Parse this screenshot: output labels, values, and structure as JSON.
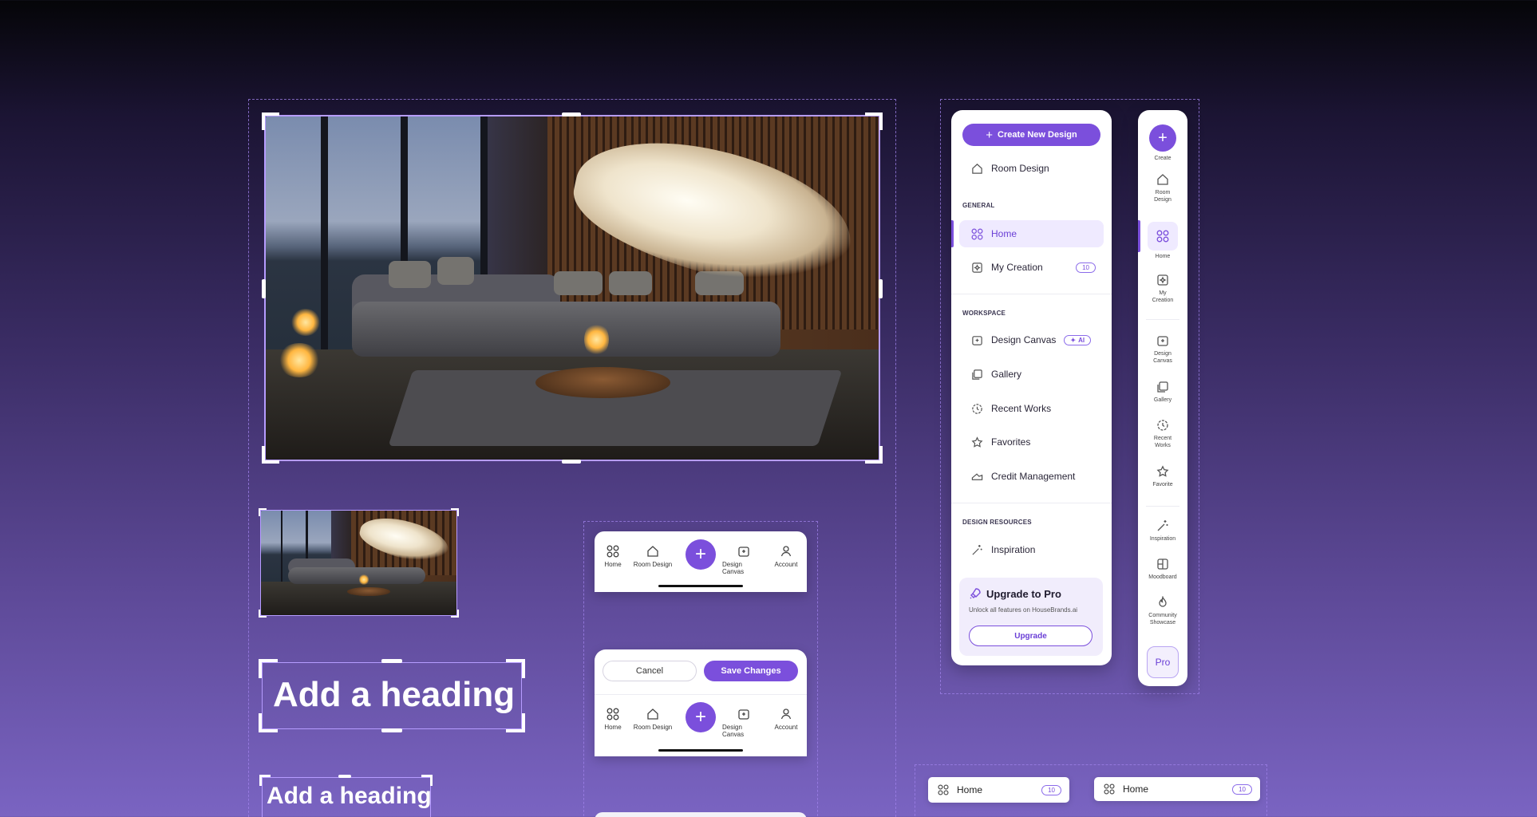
{
  "sidebar": {
    "create_label": "Create New Design",
    "room_design": "Room Design",
    "general_title": "GENERAL",
    "home": "Home",
    "my_creation": "My Creation",
    "my_creation_count": "10",
    "workspace_title": "WORKSPACE",
    "design_canvas": "Design Canvas",
    "ai_badge": "AI",
    "gallery": "Gallery",
    "recent_works": "Recent Works",
    "favorites": "Favorites",
    "credit_management": "Credit Management",
    "resources_title": "DESIGN RESOURCES",
    "inspiration": "Inspiration",
    "upgrade_title": "Upgrade to Pro",
    "upgrade_desc": "Unlock all features on HouseBrands.ai",
    "upgrade_button": "Upgrade"
  },
  "rail": {
    "create": "Create",
    "room_design": "Room Design",
    "home": "Home",
    "my_creation": "My Creation",
    "design_canvas": "Design Canvas",
    "gallery": "Gallery",
    "recent_works": "Recent Works",
    "favorite": "Favorite",
    "inspiration": "Inspiration",
    "moodboard": "Moodboard",
    "community_showcase": "Community Showcase",
    "pro": "Pro"
  },
  "mobile_nav": {
    "home": "Home",
    "room_design": "Room Design",
    "design_canvas": "Design Canvas",
    "account": "Account",
    "cancel": "Cancel",
    "save_changes": "Save Changes"
  },
  "headings": {
    "large": "Add a heading",
    "small": "Add a heading"
  },
  "chips": [
    {
      "label": "Home",
      "count": "10"
    },
    {
      "label": "Home",
      "count": "10"
    }
  ],
  "colors": {
    "accent": "#7b4fdc",
    "accent_light": "#efeaff"
  }
}
